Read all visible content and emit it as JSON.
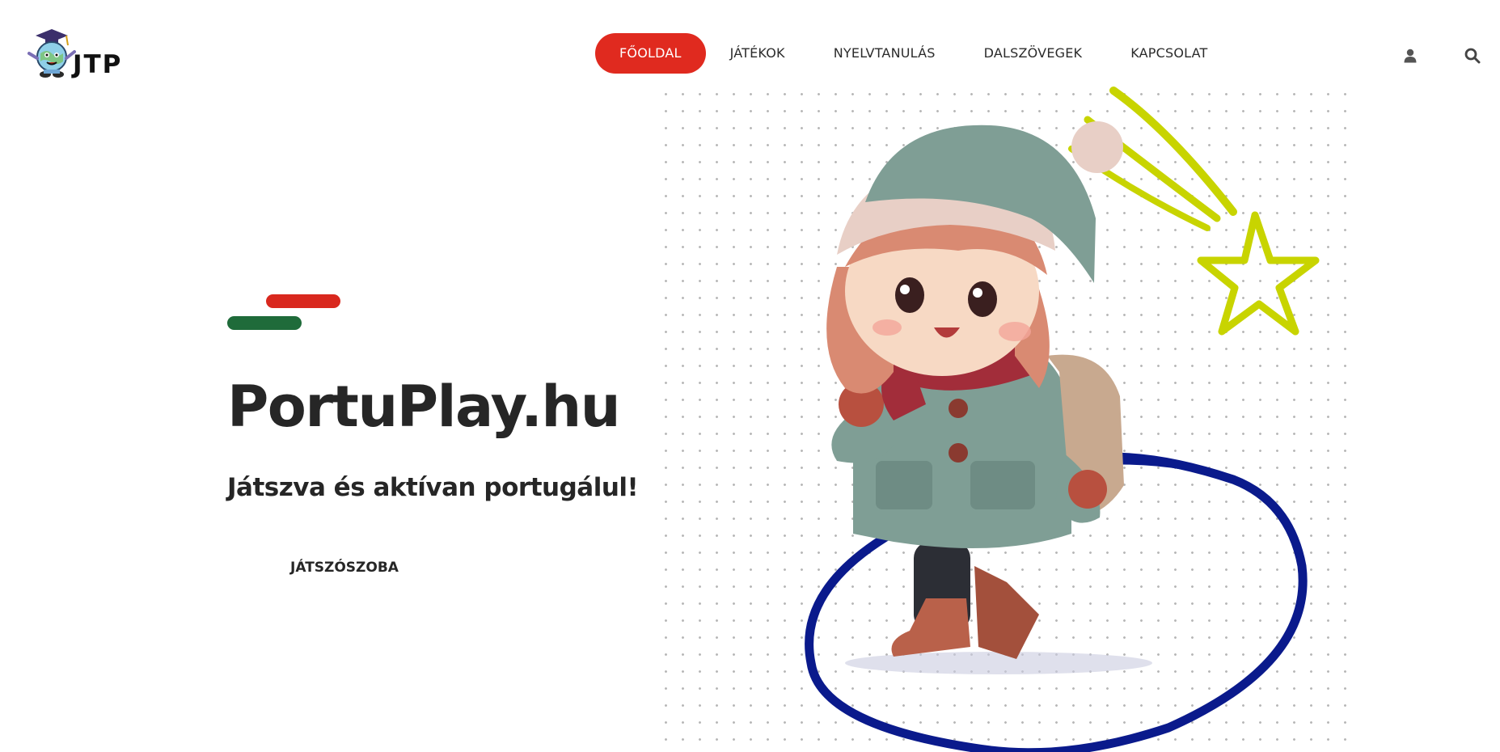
{
  "brand": {
    "logo_text": "JTP",
    "logo_icon": "graduate-globe-mascot-icon"
  },
  "nav": {
    "items": [
      {
        "label": "FŐOLDAL",
        "active": true
      },
      {
        "label": "JÁTÉKOK",
        "active": false
      },
      {
        "label": "NYELVTANULÁS",
        "active": false
      },
      {
        "label": "DALSZÖVEGEK",
        "active": false
      },
      {
        "label": "KAPCSOLAT",
        "active": false
      }
    ],
    "active_color": "#e02a1f"
  },
  "header_icons": {
    "user": "user-icon",
    "search": "search-icon"
  },
  "hero": {
    "title": "PortuPlay.hu",
    "subtitle": "Játszva és aktívan portugálul!",
    "cta_label": "JÁTSZÓSZOBA",
    "flag_colors": {
      "red": "#d9281e",
      "green": "#1f6b3a"
    }
  },
  "illustration": {
    "description_icon": "girl-winter-backpack-illustration",
    "accent_colors": {
      "circle": "#0a1a8c",
      "star": "#c8d400"
    }
  }
}
